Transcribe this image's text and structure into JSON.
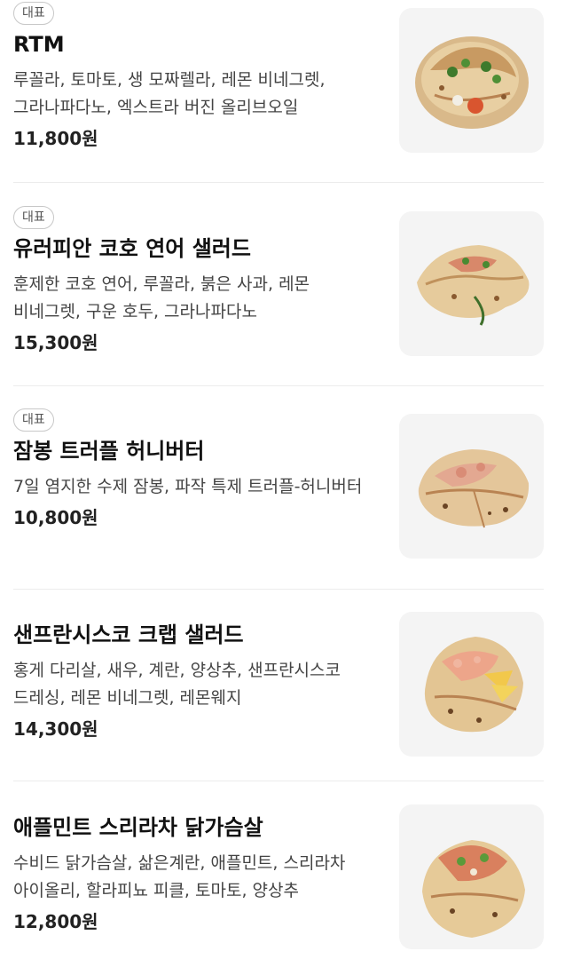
{
  "menu": {
    "items": [
      {
        "badge": "대표",
        "name": "RTM",
        "description": "루꼴라, 토마토, 생 모짜렐라, 레몬 비네그렛, 그라나파다노, 엑스트라 버진 올리브오일",
        "price": "11,800원",
        "image_icon": "pizza-sandwich-image"
      },
      {
        "badge": "대표",
        "name": "유러피안 코호 연어 샐러드",
        "description": "훈제한 코호 연어, 루꼴라, 붉은 사과, 레몬 비네그렛, 구운 호두, 그라나파다노",
        "price": "15,300원",
        "image_icon": "pizza-sandwich-image"
      },
      {
        "badge": "대표",
        "name": "잠봉 트러플 허니버터",
        "description": "7일 염지한 수제 잠봉, 파작 특제 트러플-허니버터",
        "price": "10,800원",
        "image_icon": "pizza-sandwich-image"
      },
      {
        "badge": "",
        "name": "샌프란시스코 크랩 샐러드",
        "description": "홍게 다리살, 새우, 계란, 양상추, 샌프란시스코 드레싱, 레몬 비네그렛, 레몬웨지",
        "price": "14,300원",
        "image_icon": "pizza-sandwich-image"
      },
      {
        "badge": "",
        "name": "애플민트 스리라차 닭가슴살",
        "description": "수비드 닭가슴살, 삶은계란, 애플민트, 스리라차 아이올리, 할라피뇨 피클, 토마토, 양상추",
        "price": "12,800원",
        "image_icon": "pizza-sandwich-image"
      }
    ]
  }
}
